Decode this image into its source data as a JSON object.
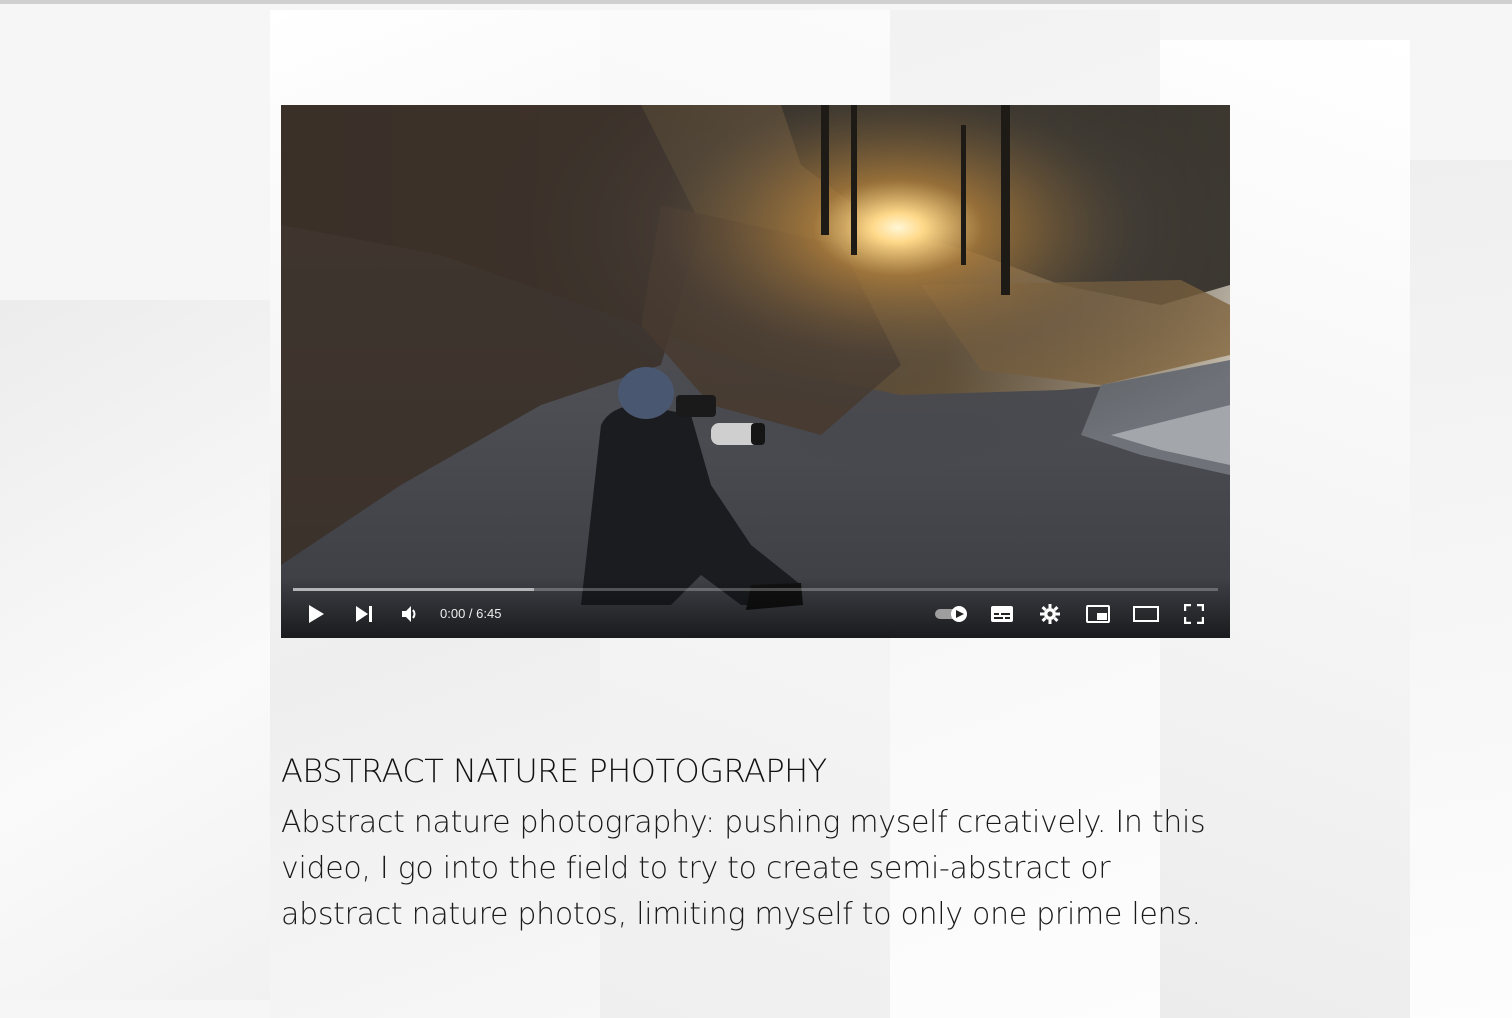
{
  "video": {
    "current_time": "0:00",
    "duration": "6:45",
    "time_display": "0:00 / 6:45",
    "progress_fraction": 0.0,
    "buffered_fraction": 0.26,
    "autoplay": "on"
  },
  "icons": {
    "play": "play-icon",
    "next": "next-icon",
    "volume": "volume-icon",
    "autoplay": "autoplay-toggle-icon",
    "subtitles": "subtitles-icon",
    "settings": "gear-icon",
    "miniplayer": "miniplayer-icon",
    "theater": "theater-mode-icon",
    "fullscreen": "fullscreen-icon"
  },
  "content": {
    "title": "ABSTRACT NATURE PHOTOGRAPHY",
    "description": "Abstract nature photography: pushing myself creatively.  In this video, I go into the field to try to create semi-abstract or abstract nature photos, limiting myself to only one prime lens."
  },
  "colors": {
    "background": "#f6f6f6",
    "text": "#111111",
    "control_icon": "#ffffff"
  }
}
